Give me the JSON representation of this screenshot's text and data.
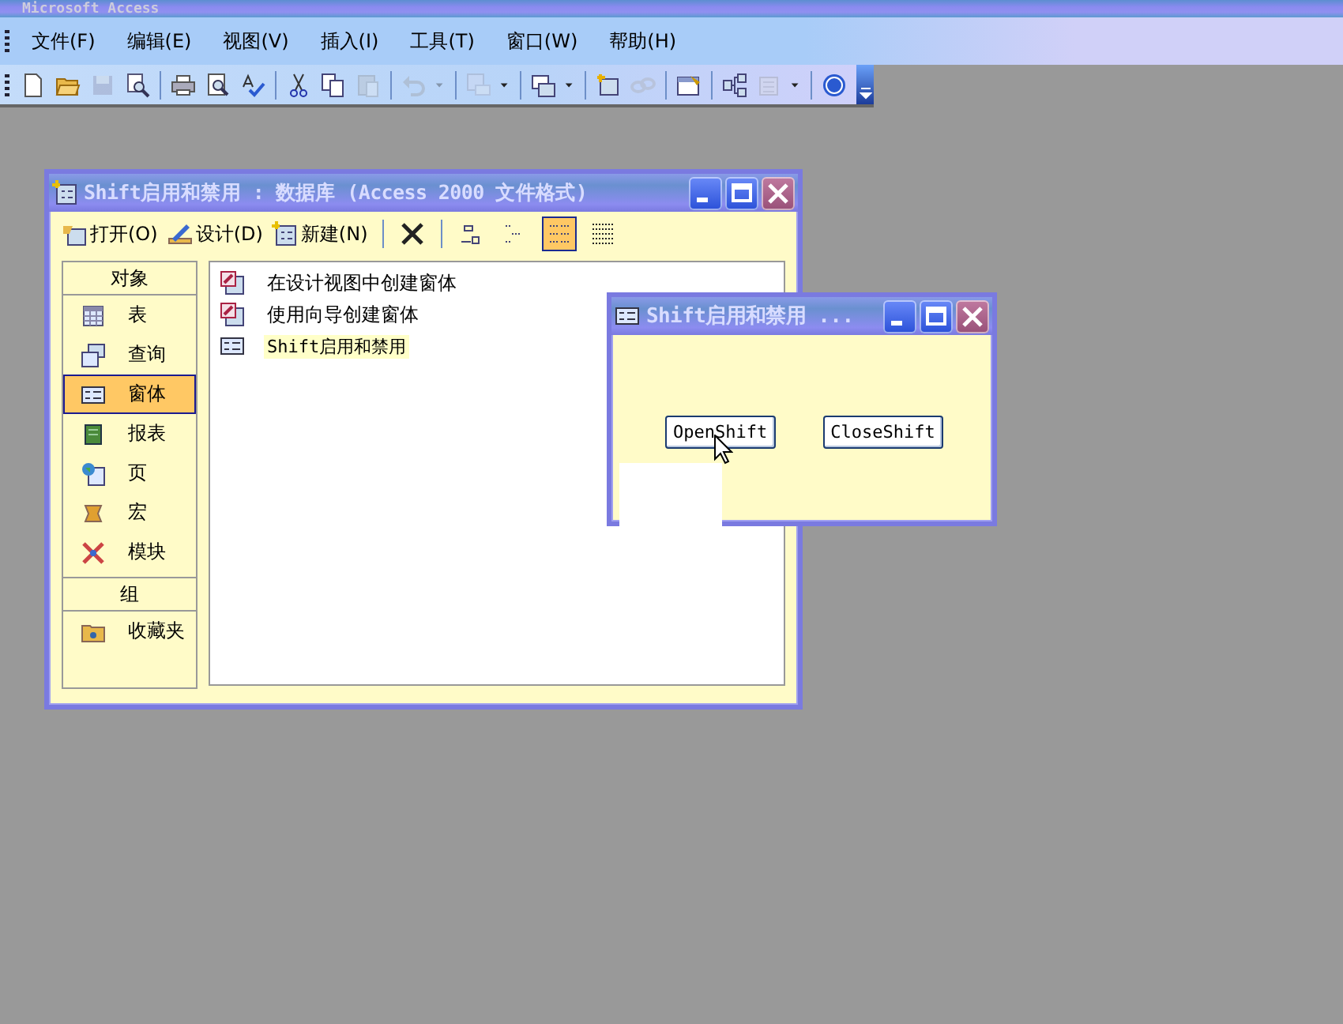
{
  "app_title": "Microsoft Access",
  "menu": [
    "文件(F)",
    "编辑(E)",
    "视图(V)",
    "插入(I)",
    "工具(T)",
    "窗口(W)",
    "帮助(H)"
  ],
  "toolbar": [
    {
      "kind": "new",
      "disabled": false
    },
    {
      "kind": "open",
      "disabled": false
    },
    {
      "kind": "save",
      "disabled": true
    },
    {
      "kind": "find",
      "disabled": false
    },
    {
      "kind": "sep"
    },
    {
      "kind": "print",
      "disabled": false
    },
    {
      "kind": "preview",
      "disabled": false
    },
    {
      "kind": "spelling",
      "disabled": false
    },
    {
      "kind": "sep"
    },
    {
      "kind": "cut",
      "disabled": false
    },
    {
      "kind": "copy",
      "disabled": false
    },
    {
      "kind": "paste",
      "disabled": true
    },
    {
      "kind": "sep"
    },
    {
      "kind": "undo",
      "disabled": true
    },
    {
      "kind": "dropdown",
      "disabled": true
    },
    {
      "kind": "sep"
    },
    {
      "kind": "links",
      "disabled": true
    },
    {
      "kind": "dropdown",
      "disabled": false
    },
    {
      "kind": "sep"
    },
    {
      "kind": "analyze",
      "disabled": false
    },
    {
      "kind": "dropdown",
      "disabled": false
    },
    {
      "kind": "sep"
    },
    {
      "kind": "code",
      "disabled": false
    },
    {
      "kind": "script",
      "disabled": true
    },
    {
      "kind": "sep"
    },
    {
      "kind": "properties",
      "disabled": false
    },
    {
      "kind": "sep"
    },
    {
      "kind": "relationships",
      "disabled": false
    },
    {
      "kind": "newobject",
      "disabled": true
    },
    {
      "kind": "dropdown",
      "disabled": false
    },
    {
      "kind": "sep"
    },
    {
      "kind": "help",
      "disabled": false
    }
  ],
  "db_window": {
    "title": "Shift启用和禁用 : 数据库 (Access 2000 文件格式)",
    "commands": [
      {
        "kind": "open",
        "label": "打开(O)"
      },
      {
        "kind": "design",
        "label": "设计(D)"
      },
      {
        "kind": "new",
        "label": "新建(N)"
      }
    ],
    "views": [
      {
        "kind": "delete",
        "selected": false
      },
      {
        "kind": "large",
        "selected": false
      },
      {
        "kind": "small",
        "selected": false
      },
      {
        "kind": "list",
        "selected": true
      },
      {
        "kind": "details",
        "selected": false
      }
    ],
    "objects_header": "对象",
    "objects": [
      {
        "kind": "table",
        "label": "表",
        "selected": false
      },
      {
        "kind": "query",
        "label": "查询",
        "selected": false
      },
      {
        "kind": "form",
        "label": "窗体",
        "selected": true
      },
      {
        "kind": "report",
        "label": "报表",
        "selected": false
      },
      {
        "kind": "page",
        "label": "页",
        "selected": false
      },
      {
        "kind": "macro",
        "label": "宏",
        "selected": false
      },
      {
        "kind": "module",
        "label": "模块",
        "selected": false
      }
    ],
    "groups_header": "组",
    "groups": [
      {
        "kind": "folder",
        "label": "收藏夹",
        "selected": false
      }
    ],
    "items": [
      {
        "kind": "wizard",
        "label": "在设计视图中创建窗体",
        "selected": false
      },
      {
        "kind": "wizard",
        "label": "使用向导创建窗体",
        "selected": false
      },
      {
        "kind": "form",
        "label": "Shift启用和禁用",
        "selected": true
      }
    ]
  },
  "form_window": {
    "title": "Shift启用和禁用 ...",
    "buttons": [
      "OpenShift",
      "CloseShift"
    ]
  }
}
